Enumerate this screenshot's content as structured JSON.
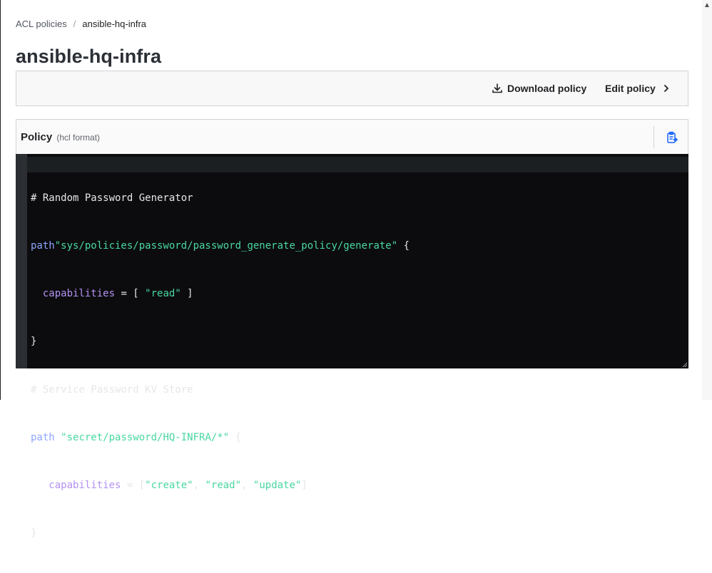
{
  "breadcrumb": {
    "parent": "ACL policies",
    "separator": "/",
    "current": "ansible-hq-infra"
  },
  "page": {
    "title": "ansible-hq-infra"
  },
  "toolbar": {
    "download_label": "Download policy",
    "download_icon": "download-icon",
    "edit_label": "Edit policy",
    "edit_icon": "chevron-right-icon"
  },
  "policy": {
    "title": "Policy",
    "format_label": "(hcl format)",
    "copy_icon": "clipboard-icon"
  },
  "code": {
    "lines": [
      {
        "comment": "# Random Password Generator"
      },
      {
        "kw": "path",
        "str": "\"sys/policies/password/password_generate_policy/generate\"",
        "rest": " {"
      },
      {
        "indent": "  ",
        "prop": "capabilities",
        "op": " = [ ",
        "str": "\"read\"",
        "rest": " ]"
      },
      {
        "rest": "}"
      },
      {
        "comment": "# Service Password KV Store"
      },
      {
        "kw": "path",
        "sp": " ",
        "str": "\"secret/password/HQ-INFRA/*\"",
        "rest": " {"
      },
      {
        "indent": "   ",
        "prop": "capabilities",
        "op": " = [",
        "s1": "\"create\"",
        "c1": ", ",
        "s2": "\"read\"",
        "c2": ", ",
        "s3": "\"update\"",
        "rest": "]"
      },
      {
        "rest": "}"
      }
    ]
  },
  "colors": {
    "editor_bg": "#0c0c0e",
    "keyword": "#8da6ff",
    "string": "#49d7a0",
    "property": "#b391f2",
    "accent": "#1563ff"
  }
}
